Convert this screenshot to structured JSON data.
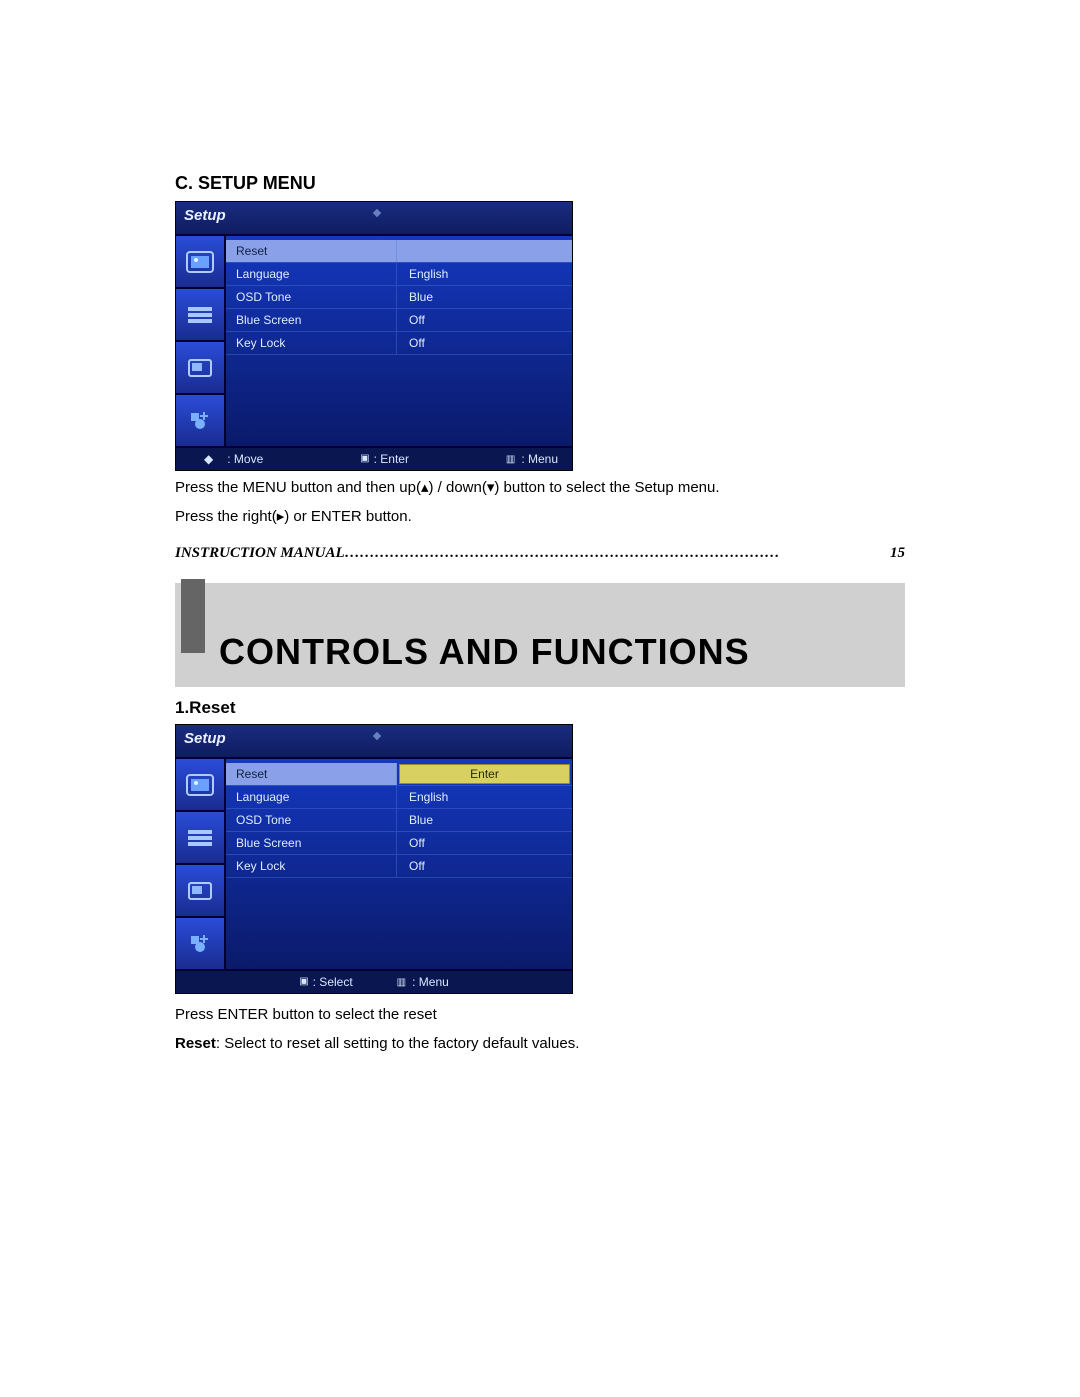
{
  "headings": {
    "setup_menu": "C. SETUP MENU",
    "reset": "1.Reset"
  },
  "osd_title": "Setup",
  "menu1": {
    "rows": [
      {
        "label": "Reset",
        "value": "",
        "selected": true
      },
      {
        "label": "Language",
        "value": "English"
      },
      {
        "label": "OSD Tone",
        "value": "Blue"
      },
      {
        "label": "Blue Screen",
        "value": "Off"
      },
      {
        "label": "Key Lock",
        "value": "Off"
      }
    ],
    "footer": {
      "move": ": Move",
      "enter": ": Enter",
      "menu": ": Menu"
    }
  },
  "menu2": {
    "rows": [
      {
        "label": "Reset",
        "value": "Enter",
        "selsplit": true
      },
      {
        "label": "Language",
        "value": "English"
      },
      {
        "label": "OSD Tone",
        "value": "Blue"
      },
      {
        "label": "Blue Screen",
        "value": "Off"
      },
      {
        "label": "Key Lock",
        "value": "Off"
      }
    ],
    "footer": {
      "select": ": Select",
      "menu": ": Menu"
    }
  },
  "paragraphs": {
    "p1": "Press the MENU button and then up(▴) / down(▾) button to select the Setup menu.",
    "p2": "Press the right(▸) or ENTER button.",
    "p3": "Press ENTER button to select the reset",
    "p4_prefix": "Reset",
    "p4_rest": ": Select to reset all setting to the factory default values."
  },
  "manual": {
    "label": "INSTRUCTION MANUAL……………………………………………………………………………",
    "page": "15"
  },
  "banner": "CONTROLS AND FUNCTIONS"
}
